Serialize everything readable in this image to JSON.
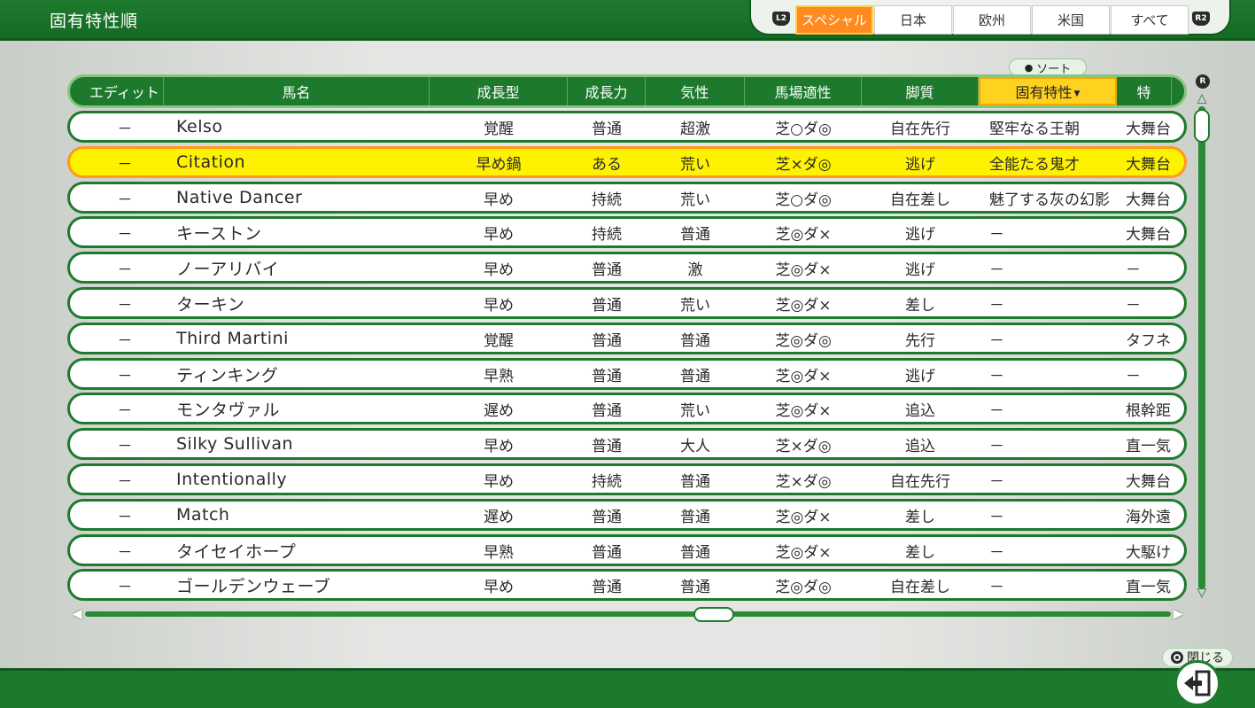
{
  "page": {
    "title": "固有特性順"
  },
  "tabs": {
    "left_button": "L2",
    "right_button": "R2",
    "items": [
      {
        "label": "スペシャル",
        "active": true
      },
      {
        "label": "日本",
        "active": false
      },
      {
        "label": "欧州",
        "active": false
      },
      {
        "label": "米国",
        "active": false
      },
      {
        "label": "すべて",
        "active": false
      }
    ]
  },
  "sort_hint": {
    "label": "ソート"
  },
  "scroll": {
    "button": "R"
  },
  "table": {
    "headers": [
      "エディット",
      "馬名",
      "成長型",
      "成長力",
      "気性",
      "馬場適性",
      "脚質",
      "固有特性",
      "特"
    ],
    "sorted_column": 7,
    "selected_row": 1,
    "rows": [
      [
        "－",
        "Kelso",
        "覚醒",
        "普通",
        "超激",
        "芝○ダ◎",
        "自在先行",
        "堅牢なる王朝",
        "大舞台"
      ],
      [
        "－",
        "Citation",
        "早め鍋",
        "ある",
        "荒い",
        "芝×ダ◎",
        "逃げ",
        "全能たる鬼才",
        "大舞台"
      ],
      [
        "－",
        "Native Dancer",
        "早め",
        "持続",
        "荒い",
        "芝○ダ◎",
        "自在差し",
        "魅了する灰の幻影",
        "大舞台"
      ],
      [
        "－",
        "キーストン",
        "早め",
        "持続",
        "普通",
        "芝◎ダ×",
        "逃げ",
        "－",
        "大舞台"
      ],
      [
        "－",
        "ノーアリバイ",
        "早め",
        "普通",
        "激",
        "芝◎ダ×",
        "逃げ",
        "－",
        "－"
      ],
      [
        "－",
        "ターキン",
        "早め",
        "普通",
        "荒い",
        "芝◎ダ×",
        "差し",
        "－",
        "－"
      ],
      [
        "－",
        "Third Martini",
        "覚醒",
        "普通",
        "普通",
        "芝◎ダ◎",
        "先行",
        "－",
        "タフネ"
      ],
      [
        "－",
        "ティンキング",
        "早熟",
        "普通",
        "普通",
        "芝◎ダ×",
        "逃げ",
        "－",
        "－"
      ],
      [
        "－",
        "モンタヴァル",
        "遅め",
        "普通",
        "荒い",
        "芝◎ダ×",
        "追込",
        "－",
        "根幹距"
      ],
      [
        "－",
        "Silky Sullivan",
        "早め",
        "普通",
        "大人",
        "芝×ダ◎",
        "追込",
        "－",
        "直一気"
      ],
      [
        "－",
        "Intentionally",
        "早め",
        "持続",
        "普通",
        "芝×ダ◎",
        "自在先行",
        "－",
        "大舞台"
      ],
      [
        "－",
        "Match",
        "遅め",
        "普通",
        "普通",
        "芝◎ダ×",
        "差し",
        "－",
        "海外遠"
      ],
      [
        "－",
        "タイセイホープ",
        "早熟",
        "普通",
        "普通",
        "芝◎ダ×",
        "差し",
        "－",
        "大駆け"
      ],
      [
        "－",
        "ゴールデンウェーブ",
        "早め",
        "普通",
        "普通",
        "芝◎ダ◎",
        "自在差し",
        "－",
        "直一気"
      ]
    ]
  },
  "footer": {
    "close_label": "閉じる"
  },
  "colors": {
    "primary_green": "#1d7a2d",
    "active_tab": "#ff8a1f",
    "sorted_header": "#ffd21f",
    "selected_row": "#fff200"
  }
}
